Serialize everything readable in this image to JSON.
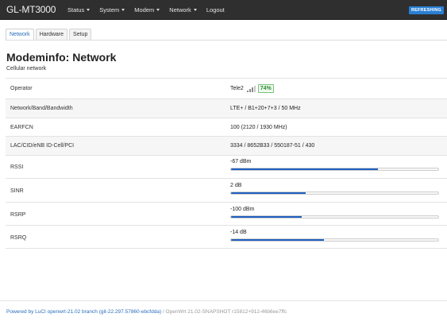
{
  "header": {
    "brand": "GL-MT3000",
    "menu": [
      {
        "label": "Status",
        "has_dropdown": true
      },
      {
        "label": "System",
        "has_dropdown": true
      },
      {
        "label": "Modem",
        "has_dropdown": true
      },
      {
        "label": "Network",
        "has_dropdown": true
      },
      {
        "label": "Logout",
        "has_dropdown": false
      }
    ],
    "refresh_badge": "REFRESHING"
  },
  "tabs": [
    {
      "label": "Network",
      "active": true
    },
    {
      "label": "Hardware",
      "active": false
    },
    {
      "label": "Setup",
      "active": false
    }
  ],
  "page": {
    "title": "Modeminfo: Network",
    "description": "Cellular network"
  },
  "rows": [
    {
      "label": "Operator",
      "value": "Tele2",
      "quality": "74%"
    },
    {
      "label": "Network/Band/Bandwidth",
      "value": "LTE+ / B1+20+7+3 / 50 MHz"
    },
    {
      "label": "EARFCN",
      "value": "100 (2120 / 1930 MHz)"
    },
    {
      "label": "LAC/CID/eNB ID-Cell/PCI",
      "value": "3334 / 8652B33 / 550187-51 / 430"
    },
    {
      "label": "RSSI",
      "value": "-67 dBm",
      "level": 0.71
    },
    {
      "label": "SINR",
      "value": "2 dB",
      "level": 0.36
    },
    {
      "label": "RSRP",
      "value": "-100 dBm",
      "level": 0.34
    },
    {
      "label": "RSRQ",
      "value": "-14 dB",
      "level": 0.45
    }
  ],
  "footer": {
    "link_text": "Powered by LuCI openwrt-21.02 branch (git-22.297.57860-ebcfdda)",
    "version_text": " / OpenWrt 21.02-SNAPSHOT r15812+912-46b6ee7ffc"
  },
  "colors": {
    "bar_fill": "#1f5fc0",
    "accent": "#2a7fd4",
    "quality_green": "#2f8a2f"
  }
}
